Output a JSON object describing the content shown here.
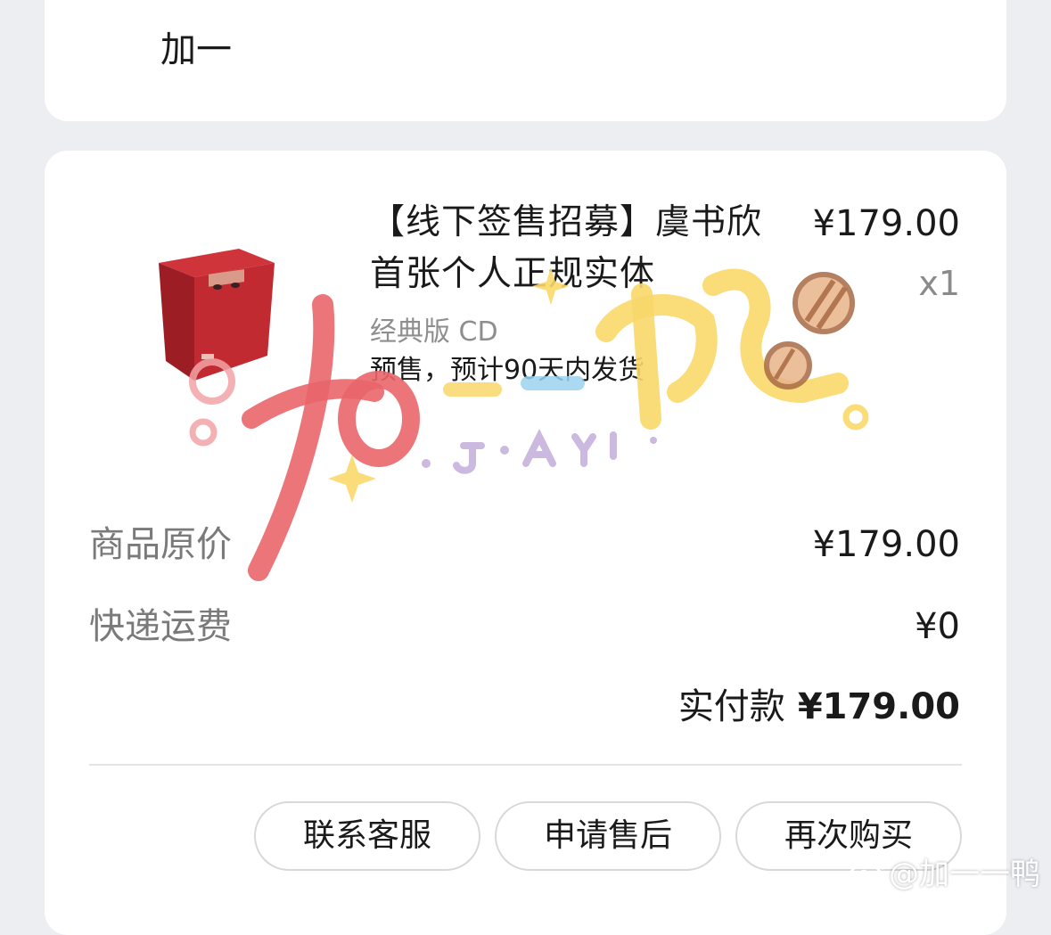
{
  "shop": {
    "name": "加一"
  },
  "product": {
    "title": "【线下签售招募】虞书欣首张个人正规实体",
    "price": "¥179.00",
    "quantity": "x1",
    "variant": "经典版 CD",
    "presale_note": "预售，预计90天内发货",
    "image_icon": "cd-box-icon"
  },
  "summary": {
    "original_price_label": "商品原价",
    "original_price_value": "¥179.00",
    "shipping_label": "快递运费",
    "shipping_value": "¥0",
    "paid_label": "实付款",
    "paid_value": "¥179.00"
  },
  "actions": {
    "contact_service": "联系客服",
    "after_sale": "申请售后",
    "buy_again": "再次购买"
  },
  "watermark": {
    "handwritten_text": "加一鸭",
    "handwritten_sub": "· JIAYI ·",
    "weibo_handle": "@加一一鸭"
  },
  "colors": {
    "background": "#EDEEF2",
    "card": "#FFFFFF",
    "product_box_red": "#B8232B",
    "watermark_red": "#E9666A",
    "watermark_yellow": "#F9D86A",
    "watermark_purple": "#C9B6DE"
  }
}
